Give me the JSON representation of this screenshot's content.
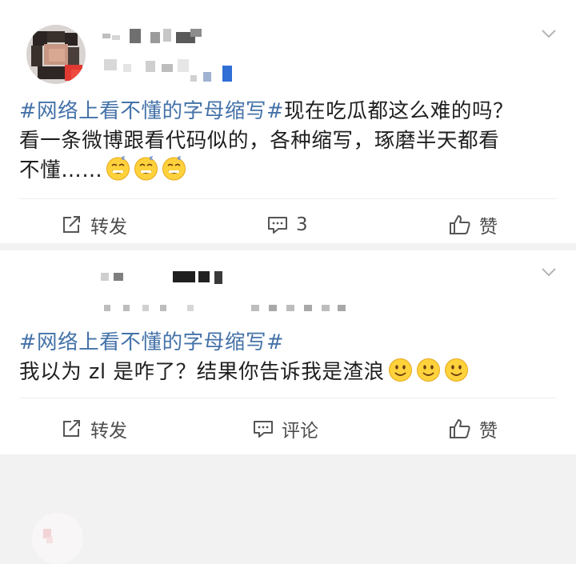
{
  "posts": [
    {
      "hashtag": "#网络上看不懂的字母缩写#",
      "text_after_tag": "现在吃瓜都这么难的吗？",
      "text_line2": "看一条微博跟看代码似的，各种缩写，琢磨半天都看",
      "text_line3": "不懂……",
      "emoji": [
        "grin-sweat",
        "grin-sweat",
        "grin-sweat"
      ],
      "actions": {
        "repost": "转发",
        "comment": "3",
        "like": "赞"
      }
    },
    {
      "hashtag": "#网络上看不懂的字母缩写#",
      "text_line2": "我以为 zl 是咋了？结果你告诉我是渣浪",
      "emoji": [
        "smile",
        "smile",
        "smile"
      ],
      "actions": {
        "repost": "转发",
        "comment": "评论",
        "like": "赞"
      }
    }
  ],
  "colors": {
    "hashtag": "#4472a8",
    "text": "#1f1f1f",
    "action": "#4d4d4d"
  },
  "icons": [
    "chevron-down-icon",
    "repost-icon",
    "comment-icon",
    "like-icon"
  ]
}
